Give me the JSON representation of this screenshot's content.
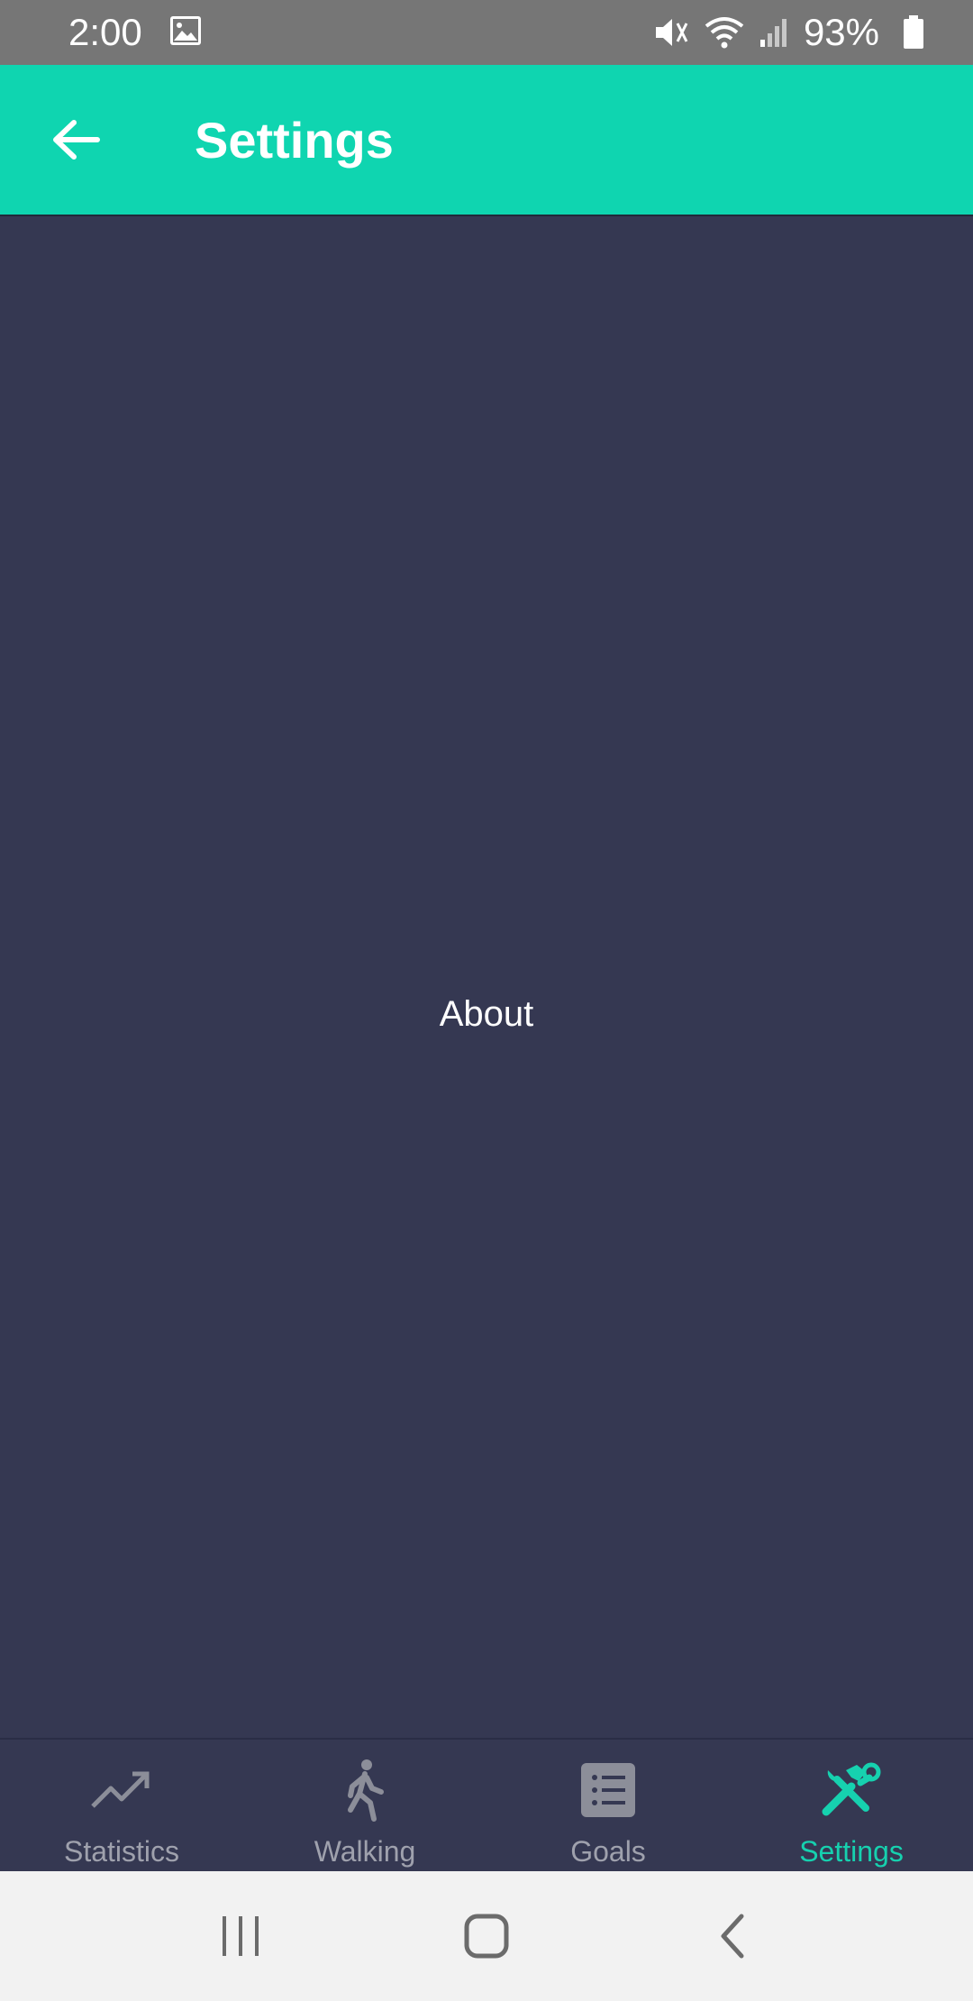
{
  "status_bar": {
    "time": "2:00",
    "battery": "93%",
    "icons": [
      "image-icon",
      "mute-icon",
      "wifi-icon",
      "signal-icon",
      "battery-icon"
    ]
  },
  "app_bar": {
    "title": "Settings",
    "back_icon": "arrow-left-icon",
    "background": "#0fd5b0"
  },
  "content": {
    "items": [
      {
        "label": "About"
      }
    ],
    "background": "#353852"
  },
  "bottom_nav": {
    "items": [
      {
        "label": "Statistics",
        "icon": "trending-up-icon",
        "active": false
      },
      {
        "label": "Walking",
        "icon": "walking-icon",
        "active": false
      },
      {
        "label": "Goals",
        "icon": "list-icon",
        "active": false
      },
      {
        "label": "Settings",
        "icon": "tools-icon",
        "active": true
      }
    ],
    "active_color": "#16d1af",
    "inactive_color": "#9fa1ad"
  },
  "system_nav": {
    "buttons": [
      "recents-icon",
      "home-icon",
      "back-icon"
    ]
  }
}
